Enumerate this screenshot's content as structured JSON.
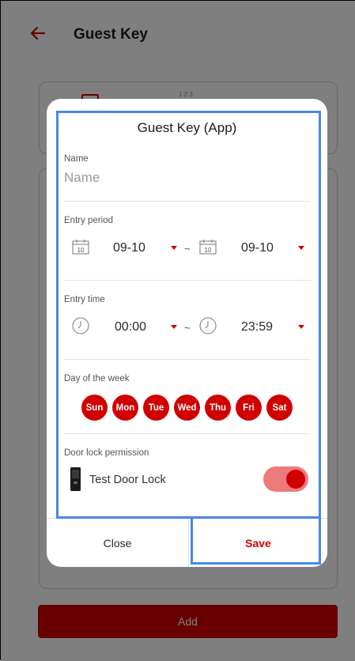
{
  "header": {
    "back_icon": "arrow-left-icon",
    "title": "Guest Key"
  },
  "background": {
    "add_label": "Add",
    "card_hint": "1 2 3"
  },
  "dialog": {
    "title": "Guest Key (App)",
    "name": {
      "label": "Name",
      "placeholder": "Name",
      "value": ""
    },
    "entry_period": {
      "label": "Entry period",
      "start": "09-10",
      "end": "09-10",
      "start_day": "10",
      "end_day": "10",
      "separator": "~"
    },
    "entry_time": {
      "label": "Entry time",
      "start": "00:00",
      "end": "23:59",
      "separator": "~"
    },
    "days": {
      "label": "Day of the week",
      "items": [
        "Sun",
        "Mon",
        "Tue",
        "Wed",
        "Thu",
        "Fri",
        "Sat"
      ],
      "selected": [
        true,
        true,
        true,
        true,
        true,
        true,
        true
      ]
    },
    "permission": {
      "label": "Door lock permission",
      "lock_name": "Test Door Lock",
      "enabled": true
    },
    "buttons": {
      "close": "Close",
      "save": "Save"
    }
  },
  "colors": {
    "accent": "#d10000",
    "toggle_track": "#ec7b7b",
    "highlight": "#4a87e3",
    "overlay": "rgba(0,0,0,0.5)"
  }
}
